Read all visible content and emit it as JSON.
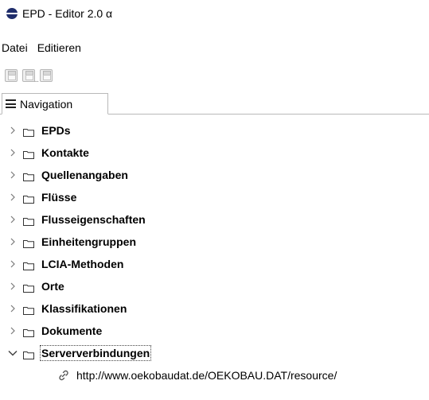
{
  "window": {
    "title": "EPD - Editor 2.0 α",
    "app_icon": "globe-icon"
  },
  "menu": {
    "items": [
      "Datei",
      "Editieren"
    ]
  },
  "toolbar": {
    "buttons": [
      "save-icon",
      "save-as-icon",
      "save-all-icon"
    ]
  },
  "tabs": [
    {
      "label": "Navigation",
      "icon": "hamburger-icon"
    }
  ],
  "tree": {
    "nodes": [
      {
        "label": "EPDs",
        "expanded": false
      },
      {
        "label": "Kontakte",
        "expanded": false
      },
      {
        "label": "Quellenangaben",
        "expanded": false
      },
      {
        "label": "Flüsse",
        "expanded": false
      },
      {
        "label": "Flusseigenschaften",
        "expanded": false
      },
      {
        "label": "Einheitengruppen",
        "expanded": false
      },
      {
        "label": "LCIA-Methoden",
        "expanded": false
      },
      {
        "label": "Orte",
        "expanded": false
      },
      {
        "label": "Klassifikationen",
        "expanded": false
      },
      {
        "label": "Dokumente",
        "expanded": false
      },
      {
        "label": "Serververbindungen",
        "expanded": true,
        "focused": true
      }
    ],
    "children": {
      "Serververbindungen": [
        {
          "url": "http://www.oekobaudat.de/OEKOBAU.DAT/resource/",
          "icon": "link-icon"
        }
      ]
    }
  },
  "colors": {
    "accent": "#1f2d6b",
    "tab_border": "#b9b9b9",
    "chevron": "#7a7a7a"
  }
}
